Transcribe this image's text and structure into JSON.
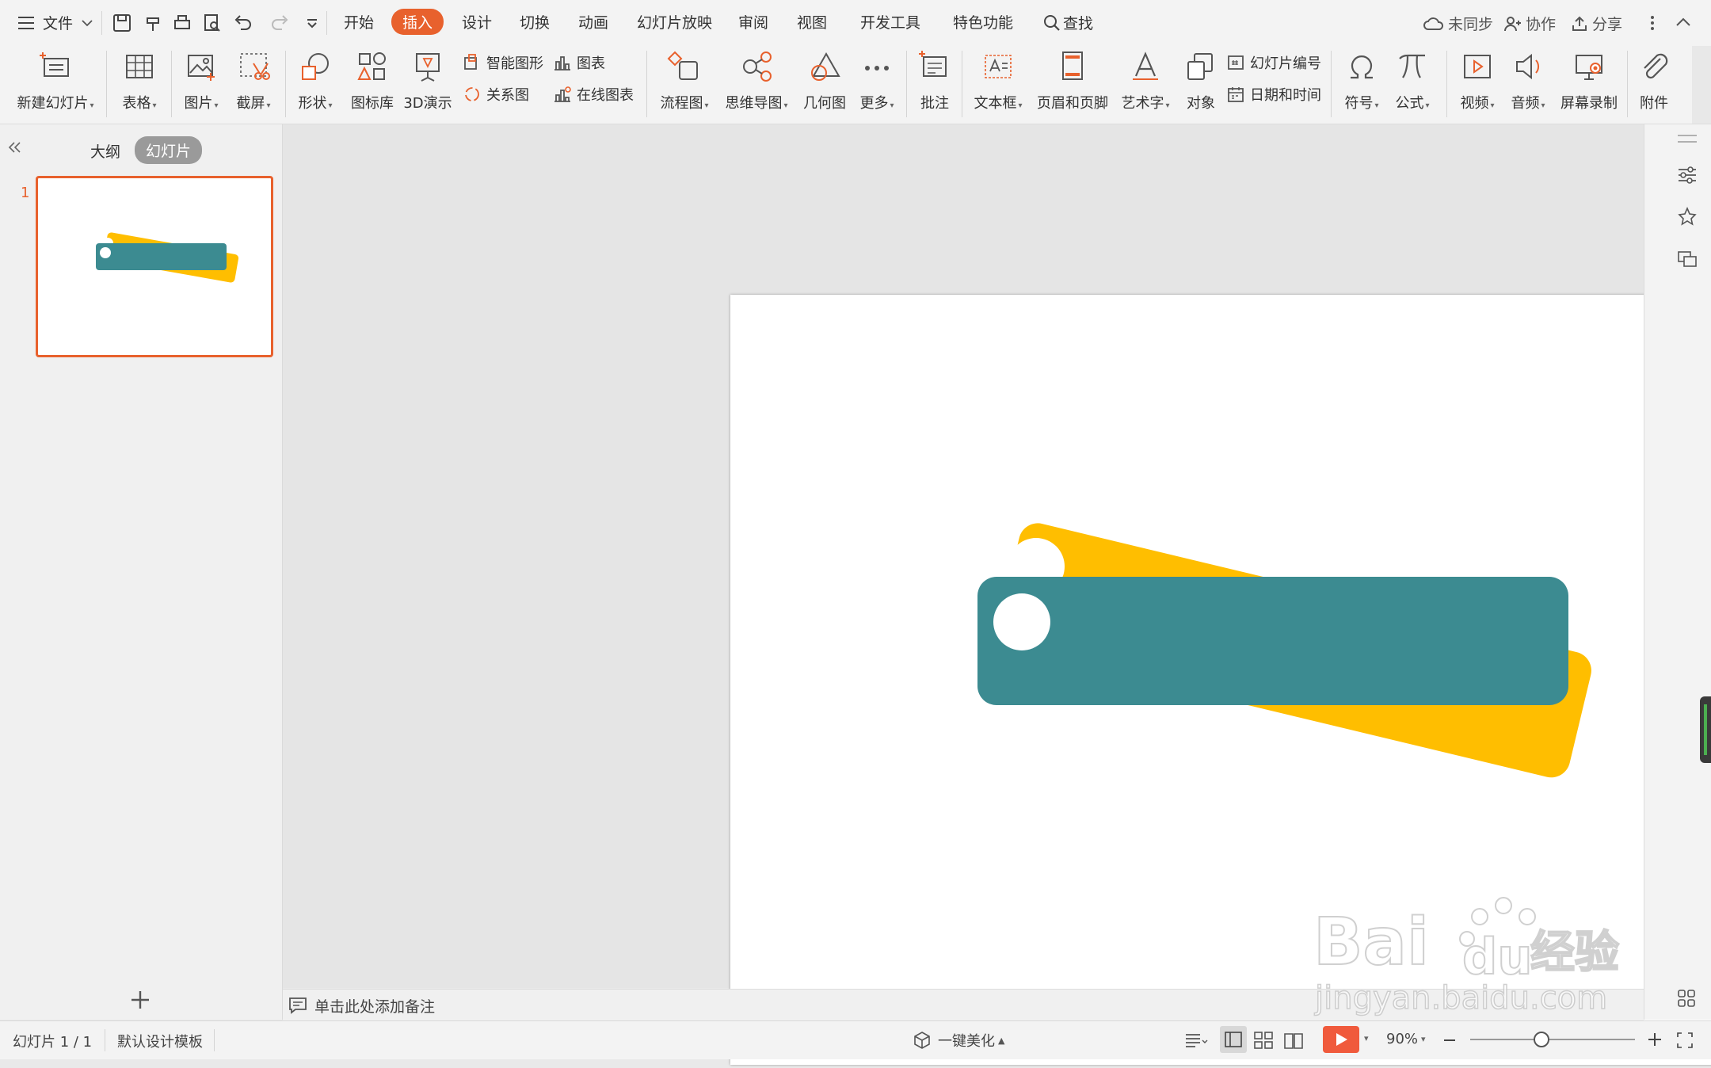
{
  "menubar": {
    "file_label": "文件",
    "tabs": [
      "开始",
      "插入",
      "设计",
      "切换",
      "动画",
      "幻灯片放映",
      "审阅",
      "视图",
      "开发工具",
      "特色功能"
    ],
    "active_tab": "插入",
    "search_label": "查找",
    "sync_label": "未同步",
    "collab_label": "协作",
    "share_label": "分享"
  },
  "ribbon": {
    "new_slide": "新建幻灯片",
    "table": "表格",
    "picture": "图片",
    "screenshot": "截屏",
    "shape": "形状",
    "icon_lib": "图标库",
    "demo3d": "3D演示",
    "smart_graphic": "智能图形",
    "chart": "图表",
    "relation": "关系图",
    "online_chart": "在线图表",
    "flowchart": "流程图",
    "mindmap": "思维导图",
    "geometry": "几何图",
    "more": "更多",
    "comment": "批注",
    "textbox": "文本框",
    "header_footer": "页眉和页脚",
    "wordart": "艺术字",
    "object": "对象",
    "slide_number": "幻灯片编号",
    "datetime": "日期和时间",
    "symbol": "符号",
    "formula": "公式",
    "video": "视频",
    "audio": "音频",
    "screen_record": "屏幕录制",
    "attachment": "附件"
  },
  "left_panel": {
    "tab_outline": "大纲",
    "tab_slides": "幻灯片",
    "slide_number": "1"
  },
  "notes": {
    "placeholder": "单击此处添加备注"
  },
  "statusbar": {
    "slide_info": "幻灯片 1 / 1",
    "template": "默认设计模板",
    "beautify": "一键美化",
    "zoom": "90%"
  },
  "colors": {
    "accent": "#e8612d",
    "teal": "#3c8b91",
    "yellow": "#ffbe00"
  }
}
